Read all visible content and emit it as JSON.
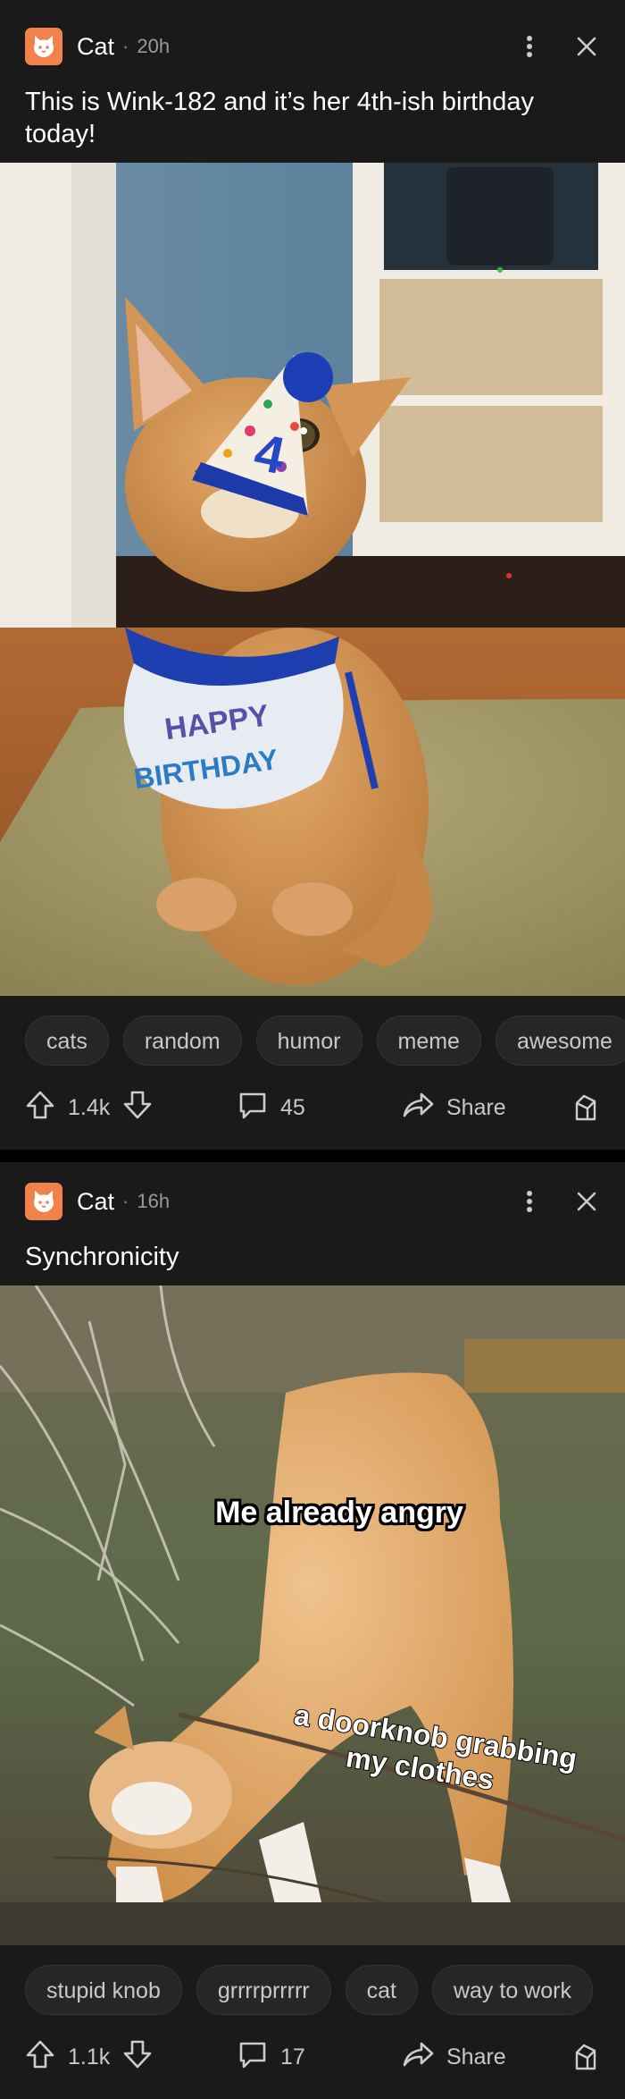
{
  "posts": [
    {
      "community": "Cat",
      "time": "20h",
      "title": "This is Wink-182 and it’s her 4th-ish birthday today!",
      "image": {
        "hat_number": "4",
        "bib_line1": "HAPPY",
        "bib_line2": "BIRTHDAY"
      },
      "tags": [
        "cats",
        "random",
        "humor",
        "meme",
        "awesome"
      ],
      "votes": "1.4k",
      "comments": "45",
      "share_label": "Share"
    },
    {
      "community": "Cat",
      "time": "16h",
      "title": "Synchronicity",
      "image": {
        "caption_top": "Me already angry",
        "caption_bottom_1": "a doorknob grabbing",
        "caption_bottom_2": "my clothes"
      },
      "tags": [
        "stupid knob",
        "grrrrprrrrr",
        "cat",
        "way to work"
      ],
      "votes": "1.1k",
      "comments": "17",
      "share_label": "Share"
    }
  ],
  "icons": {
    "avatar": "cat-face-icon",
    "more": "more-vertical-icon",
    "close": "close-icon",
    "upvote": "arrow-up-icon",
    "downvote": "arrow-down-icon",
    "comment": "comment-bubble-icon",
    "share": "share-arrow-icon",
    "award": "award-icon"
  },
  "colors": {
    "background": "#1a1a1a",
    "avatar": "#f2824c",
    "tag_bg": "#262626",
    "text_muted": "#c8c8c8"
  }
}
